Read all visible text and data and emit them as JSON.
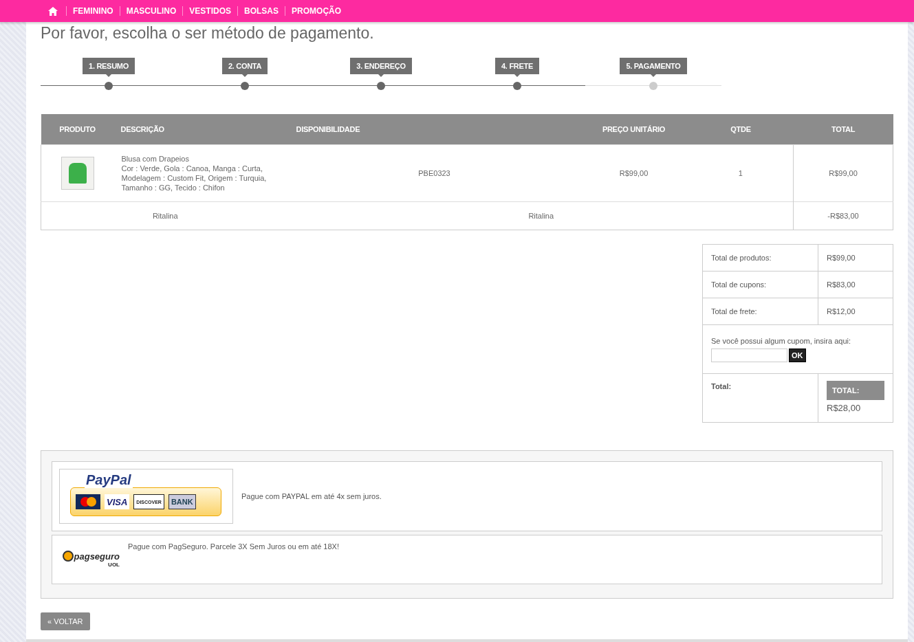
{
  "nav": {
    "items": [
      "FEMININO",
      "MASCULINO",
      "VESTIDOS",
      "BOLSAS",
      "PROMOÇÃO"
    ]
  },
  "heading": "Por favor, escolha o ser método de pagamento.",
  "steps": [
    {
      "label": "1. RESUMO",
      "done": true
    },
    {
      "label": "2. CONTA",
      "done": true
    },
    {
      "label": "3. ENDEREÇO",
      "done": true
    },
    {
      "label": "4. FRETE",
      "done": true
    },
    {
      "label": "5. PAGAMENTO",
      "done": false
    }
  ],
  "cart": {
    "columns": [
      "PRODUTO",
      "DESCRIÇÃO",
      "DISPONIBILIDADE",
      "PREÇO UNITÁRIO",
      "QTDE",
      "TOTAL"
    ],
    "rows": [
      {
        "description": [
          "Blusa com Drapeios",
          "Cor : Verde, Gola : Canoa, Manga : Curta,",
          "Modelagem : Custom Fit, Origem : Turquia,",
          "Tamanho : GG, Tecido : Chifon"
        ],
        "availability": "PBE0323",
        "unit_price": "R$99,00",
        "qty": "1",
        "total": "R$99,00"
      }
    ],
    "coupon_row": {
      "name": "Ritalina",
      "description": "Ritalina",
      "total": "-R$83,00"
    }
  },
  "summary": {
    "lines": [
      {
        "label": "Total de produtos:",
        "value": "R$99,00"
      },
      {
        "label": "Total de cupons:",
        "value": "R$83,00"
      },
      {
        "label": "Total de frete:",
        "value": "R$12,00"
      }
    ],
    "coupon_prompt": "Se você possui algum cupom, insira aqui:",
    "ok_button": "OK",
    "total_label": "Total:",
    "total_badge": "TOTAL:",
    "total_value": "R$28,00"
  },
  "payments": [
    {
      "kind": "paypal",
      "wordmark": "PayPal",
      "cards": [
        "VISA",
        "DISCOVER",
        "BANK"
      ],
      "text": "Pague com PAYPAL em até 4x sem juros."
    },
    {
      "kind": "pagseguro",
      "wordmark": "pagseguro",
      "sub": "UOL",
      "text": "Pague com PagSeguro. Parcele 3X Sem Juros ou em até 18X!"
    }
  ],
  "back_button": "« VOLTAR"
}
